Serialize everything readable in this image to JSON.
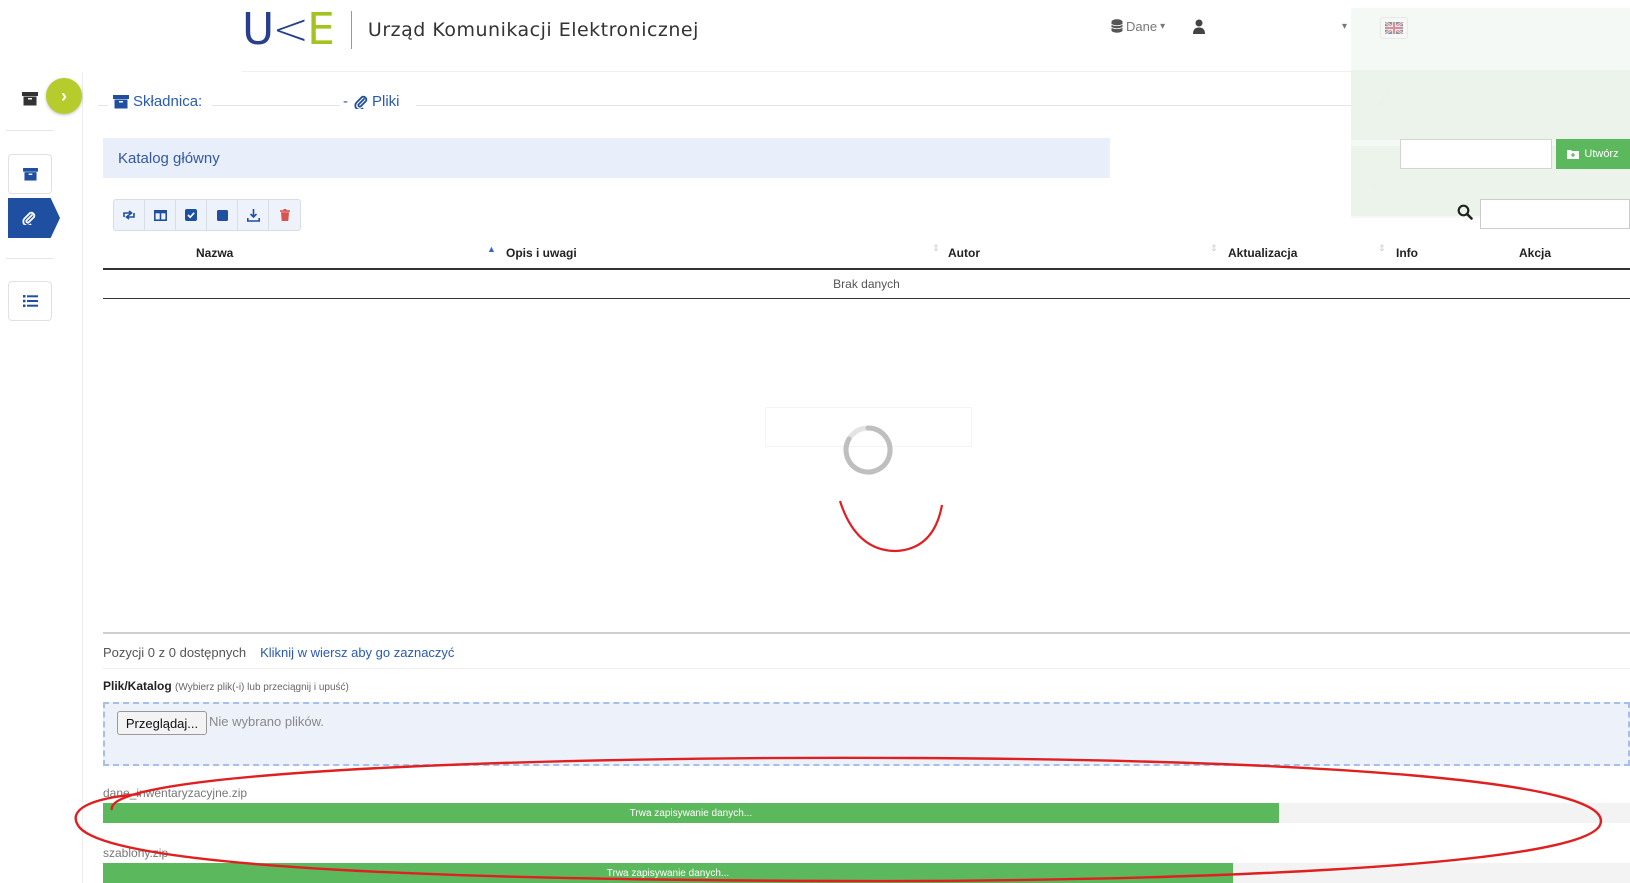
{
  "header": {
    "logo_u": "U",
    "logo_mid": "<",
    "logo_e": "E",
    "org_name": "Urząd Komunikacji Elektronicznej",
    "data_menu_label": "Dane",
    "data_menu_caret": "▾",
    "user_caret": "▾"
  },
  "breadcrumb": {
    "repository_label": "Składnica:",
    "separator": "-",
    "files_label": "Pliki"
  },
  "catalog": {
    "title": "Katalog główny"
  },
  "create_button_label": "Utwórz",
  "table": {
    "columns": [
      "Nazwa",
      "Opis i uwagi",
      "Autor",
      "Aktualizacja",
      "Info",
      "Akcja"
    ],
    "empty_text": "Brak danych"
  },
  "pagination": {
    "summary": "Pozycji 0 z 0 dostępnych",
    "hint": "Kliknij w wiersz aby go zaznaczyć"
  },
  "upload": {
    "field_label": "Plik/Katalog",
    "field_hint": "(Wybierz plik(-i) lub przeciągnij i upuść)",
    "browse_label": "Przeglądaj...",
    "no_files_text": "Nie wybrano plików.",
    "items": [
      {
        "name": "dane_inwentaryzacyjne.zip",
        "status": "Trwa zapisywanie danych...",
        "progress": 0.77
      },
      {
        "name": "szablony.zip",
        "status": "Trwa zapisywanie danych...",
        "progress": 0.74
      }
    ]
  },
  "colors": {
    "accent_blue": "#1f4fa0",
    "brand_green": "#a3c41f",
    "progress_green": "#5cb85c",
    "annotation_red": "#e02020"
  }
}
